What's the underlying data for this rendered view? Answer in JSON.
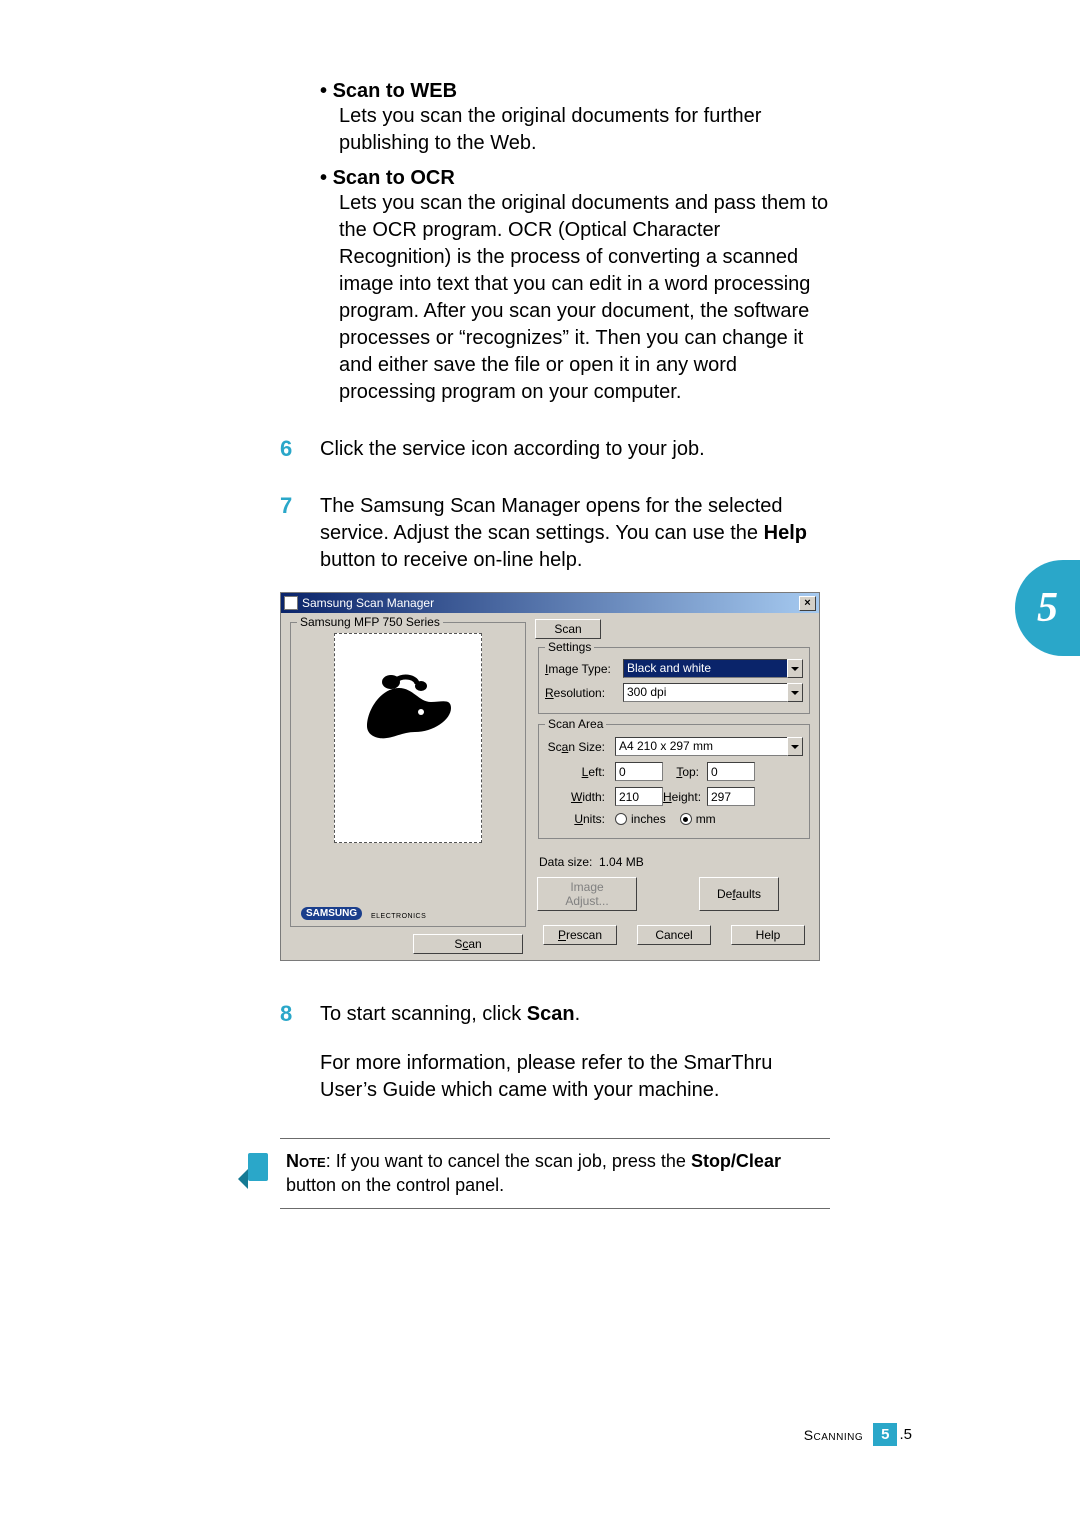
{
  "items": {
    "scan_web_title": "Scan to WEB",
    "scan_web_body": "Lets you scan the original documents for further publishing to the Web.",
    "scan_ocr_title": "Scan to OCR",
    "scan_ocr_body": "Lets you scan the original documents and pass them to the OCR program. OCR (Optical Character Recognition) is the process of converting a scanned image into text that you can edit in a word processing program. After you scan your document, the software processes or “recognizes” it. Then you can change it and either save the file or open it in any word processing program on your computer."
  },
  "steps": {
    "s6_num": "6",
    "s6_text": "Click the service icon according to your job.",
    "s7_num": "7",
    "s7_text_a": "The Samsung Scan Manager opens for the selected service. Adjust the scan settings. You can use the ",
    "s7_help": "Help",
    "s7_text_b": " button to receive on-line help.",
    "s8_num": "8",
    "s8_text_a": "To start scanning, click ",
    "s8_scan": "Scan",
    "s8_text_b": ".",
    "s8_para": "For more information, please refer to the SmarThru User’s Guide which came with your machine."
  },
  "note": {
    "label": "Note",
    "text_a": ": If you want to cancel the scan job, press the ",
    "bold": "Stop/Clear",
    "text_b": " button on the control panel."
  },
  "dialog": {
    "title": "Samsung Scan Manager",
    "fieldset_label": "Samsung MFP 750 Series",
    "scan_btn_left": "Scan",
    "scan_btn_top": "Scan",
    "settings": {
      "legend": "Settings",
      "image_type_label": "Image Type:",
      "image_type_value": "Black and white",
      "resolution_label": "Resolution:",
      "resolution_value": "300 dpi"
    },
    "scan_area": {
      "legend": "Scan Area",
      "scan_size_label": "Scan Size:",
      "scan_size_value": "A4 210 x 297 mm",
      "left_label": "Left:",
      "left_value": "0",
      "top_label": "Top:",
      "top_value": "0",
      "width_label": "Width:",
      "width_value": "210",
      "height_label": "Height:",
      "height_value": "297",
      "units_label": "Units:",
      "units_inches": "inches",
      "units_mm": "mm"
    },
    "data_size_label": "Data size:",
    "data_size_value": "1.04 MB",
    "image_adjust": "Image Adjust...",
    "defaults": "Defaults",
    "prescan": "Prescan",
    "cancel": "Cancel",
    "help": "Help",
    "logo": "SAMSUNG",
    "logo_sub": "ELECTRONICS"
  },
  "side_tab": "5",
  "footer": {
    "section": "Scanning",
    "chapter": "5",
    "page": ".5"
  }
}
